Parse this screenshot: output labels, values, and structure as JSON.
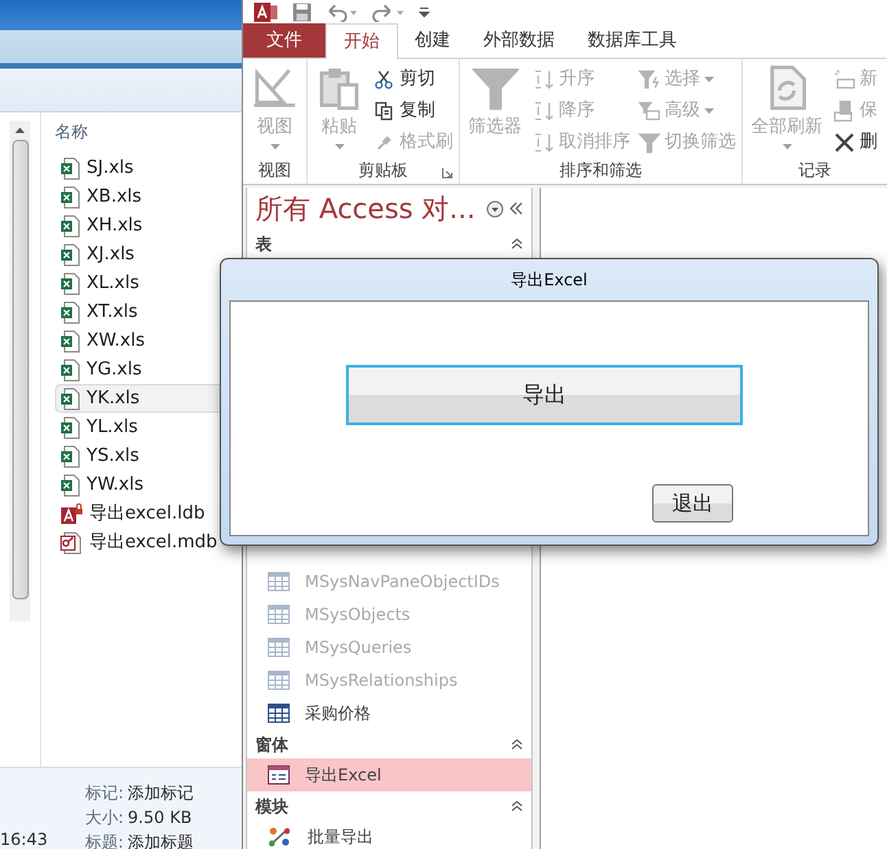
{
  "explorer": {
    "column_header": "名称",
    "files": [
      {
        "name": "SJ.xls",
        "kind": "excel",
        "selected": false
      },
      {
        "name": "XB.xls",
        "kind": "excel",
        "selected": false
      },
      {
        "name": "XH.xls",
        "kind": "excel",
        "selected": false
      },
      {
        "name": "XJ.xls",
        "kind": "excel",
        "selected": false
      },
      {
        "name": "XL.xls",
        "kind": "excel",
        "selected": false
      },
      {
        "name": "XT.xls",
        "kind": "excel",
        "selected": false
      },
      {
        "name": "XW.xls",
        "kind": "excel",
        "selected": false
      },
      {
        "name": "YG.xls",
        "kind": "excel",
        "selected": false
      },
      {
        "name": "YK.xls",
        "kind": "excel",
        "selected": true
      },
      {
        "name": "YL.xls",
        "kind": "excel",
        "selected": false
      },
      {
        "name": "YS.xls",
        "kind": "excel",
        "selected": false
      },
      {
        "name": "YW.xls",
        "kind": "excel",
        "selected": false
      },
      {
        "name": "导出excel.ldb",
        "kind": "lock",
        "selected": false
      },
      {
        "name": "导出excel.mdb",
        "kind": "database",
        "selected": false
      }
    ],
    "time": "16:43",
    "details": [
      {
        "label": "标记:",
        "value": "添加标记"
      },
      {
        "label": "大小:",
        "value": "9.50 KB"
      },
      {
        "label": "标题:",
        "value": "添加标题"
      }
    ]
  },
  "access": {
    "tabs": [
      {
        "label": "文件",
        "kind": "file",
        "selected": false
      },
      {
        "label": "开始",
        "kind": "tab",
        "selected": true
      },
      {
        "label": "创建",
        "kind": "tab",
        "selected": false
      },
      {
        "label": "外部数据",
        "kind": "tab",
        "selected": false
      },
      {
        "label": "数据库工具",
        "kind": "tab",
        "selected": false
      }
    ],
    "ribbon": [
      {
        "label": "视图",
        "large": {
          "label": "视图",
          "kind": "view",
          "disabled": true,
          "dropdown": true
        }
      },
      {
        "label": "剪贴板",
        "launcher": true,
        "large": {
          "label": "粘贴",
          "kind": "paste",
          "disabled": true,
          "dropdown": true
        },
        "small": [
          {
            "label": "剪切",
            "kind": "cut",
            "disabled": false
          },
          {
            "label": "复制",
            "kind": "copy",
            "disabled": false
          },
          {
            "label": "格式刷",
            "kind": "brush",
            "disabled": true
          }
        ]
      },
      {
        "label": "排序和筛选",
        "large": {
          "label": "筛选器",
          "kind": "filter",
          "disabled": true
        },
        "small": [
          {
            "label": "升序",
            "kind": "sort-asc",
            "disabled": true
          },
          {
            "label": "降序",
            "kind": "sort-desc",
            "disabled": true
          },
          {
            "label": "取消排序",
            "kind": "clear-sort",
            "disabled": true
          },
          {
            "label": "选择",
            "kind": "selection",
            "disabled": true,
            "dropdown": true
          },
          {
            "label": "高级",
            "kind": "advanced",
            "disabled": true,
            "dropdown": true
          },
          {
            "label": "切换筛选",
            "kind": "toggle-filter",
            "disabled": true
          }
        ]
      },
      {
        "label": "记录",
        "large": {
          "label": "全部刷新",
          "kind": "refresh",
          "disabled": true,
          "dropdown": true
        },
        "small": [
          {
            "label": "新",
            "kind": "new",
            "disabled": true
          },
          {
            "label": "保",
            "kind": "save",
            "disabled": true
          },
          {
            "label": "删",
            "kind": "delete",
            "disabled": false
          }
        ]
      }
    ],
    "nav_pane": {
      "title": "所有 Access 对...",
      "groups": [
        {
          "label": "表",
          "items": [
            {
              "label": "MSysNavPaneObjectIDs",
              "kind": "table",
              "disabled": true,
              "selected": false
            },
            {
              "label": "MSysObjects",
              "kind": "table",
              "disabled": true,
              "selected": false
            },
            {
              "label": "MSysQueries",
              "kind": "table",
              "disabled": true,
              "selected": false
            },
            {
              "label": "MSysRelationships",
              "kind": "table",
              "disabled": true,
              "selected": false
            },
            {
              "label": "采购价格",
              "kind": "table",
              "disabled": false,
              "selected": false
            }
          ]
        },
        {
          "label": "窗体",
          "items": [
            {
              "label": "导出Excel",
              "kind": "form",
              "disabled": false,
              "selected": true
            }
          ]
        },
        {
          "label": "模块",
          "items": [
            {
              "label": "批量导出",
              "kind": "module",
              "disabled": false,
              "selected": false
            }
          ]
        }
      ]
    }
  },
  "dialog": {
    "title": "导出Excel",
    "buttons": [
      {
        "label": "导出",
        "kind": "primary"
      },
      {
        "label": "退出",
        "kind": "default"
      }
    ]
  }
}
